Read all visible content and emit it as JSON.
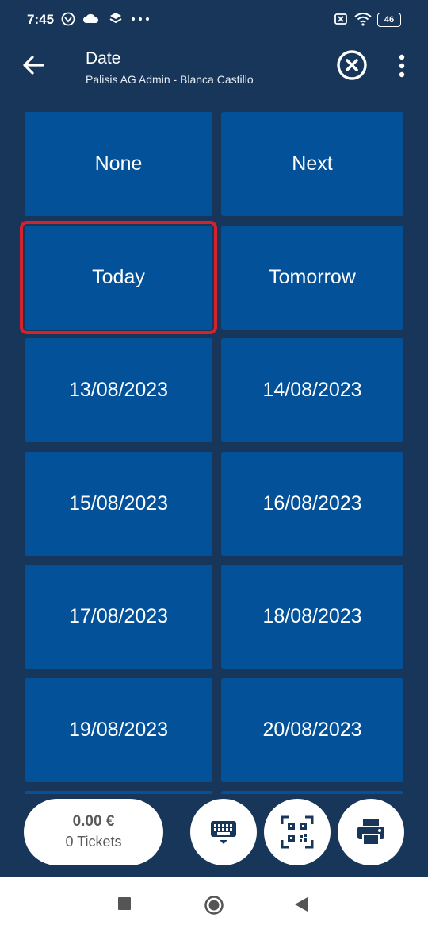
{
  "status_bar": {
    "time": "7:45",
    "battery": "46",
    "icons": [
      "vpn-icon",
      "cloud-icon",
      "layers-icon",
      "more-dots-icon",
      "no-sim-icon",
      "wifi-icon",
      "battery-icon"
    ]
  },
  "app_bar": {
    "title": "Date",
    "subtitle": "Palisis AG Admin - Blanca Castillo"
  },
  "grid": {
    "tiles": [
      {
        "label": "None"
      },
      {
        "label": "Next"
      },
      {
        "label": "Today",
        "selected": true
      },
      {
        "label": "Tomorrow"
      },
      {
        "label": "13/08/2023"
      },
      {
        "label": "14/08/2023"
      },
      {
        "label": "15/08/2023"
      },
      {
        "label": "16/08/2023"
      },
      {
        "label": "17/08/2023"
      },
      {
        "label": "18/08/2023"
      },
      {
        "label": "19/08/2023"
      },
      {
        "label": "20/08/2023"
      }
    ]
  },
  "cart": {
    "amount": "0.00 €",
    "tickets": "0 Tickets"
  },
  "colors": {
    "background": "#173659",
    "tile": "#035199",
    "selection": "#d3232f"
  }
}
